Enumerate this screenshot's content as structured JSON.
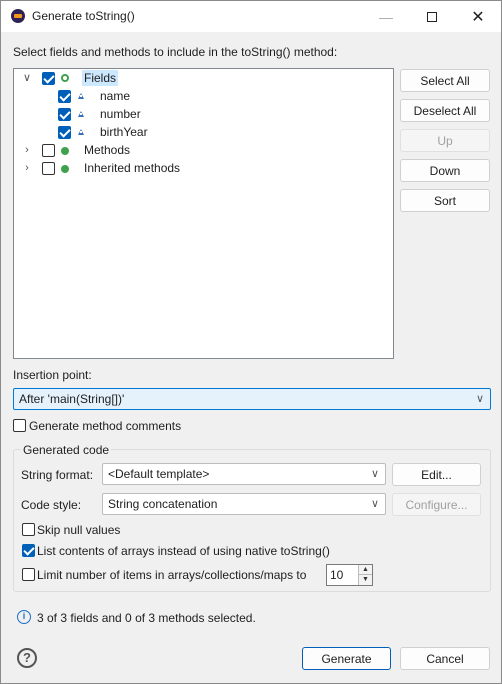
{
  "window": {
    "title": "Generate toString()"
  },
  "instruction": "Select fields and methods to include in the toString() method:",
  "tree": {
    "fields_label": "Fields",
    "fields": [
      "name",
      "number",
      "birthYear"
    ],
    "methods_label": "Methods",
    "inherited_label": "Inherited methods"
  },
  "side_buttons": {
    "select_all": "Select All",
    "deselect_all": "Deselect All",
    "up": "Up",
    "down": "Down",
    "sort": "Sort"
  },
  "insertion": {
    "label": "Insertion point:",
    "value": "After 'main(String[])'"
  },
  "generate_comments": {
    "label": "Generate method comments",
    "checked": false
  },
  "generated_code": {
    "group_label": "Generated code",
    "string_format_label": "String format:",
    "string_format_value": "<Default template>",
    "edit_button": "Edit...",
    "code_style_label": "Code style:",
    "code_style_value": "String concatenation",
    "configure_button": "Configure...",
    "skip_null_label": "Skip null values",
    "skip_null_checked": false,
    "list_arrays_label": "List contents of arrays instead of using native toString()",
    "list_arrays_checked": true,
    "limit_label": "Limit number of items in arrays/collections/maps to",
    "limit_checked": false,
    "limit_value": "10"
  },
  "status": "3 of 3 fields and 0 of 3 methods selected.",
  "footer": {
    "generate": "Generate",
    "cancel": "Cancel"
  },
  "colors": {
    "accent": "#005fb8",
    "field_icon": "#3b6fb5",
    "green_icon": "#3fa14b"
  }
}
